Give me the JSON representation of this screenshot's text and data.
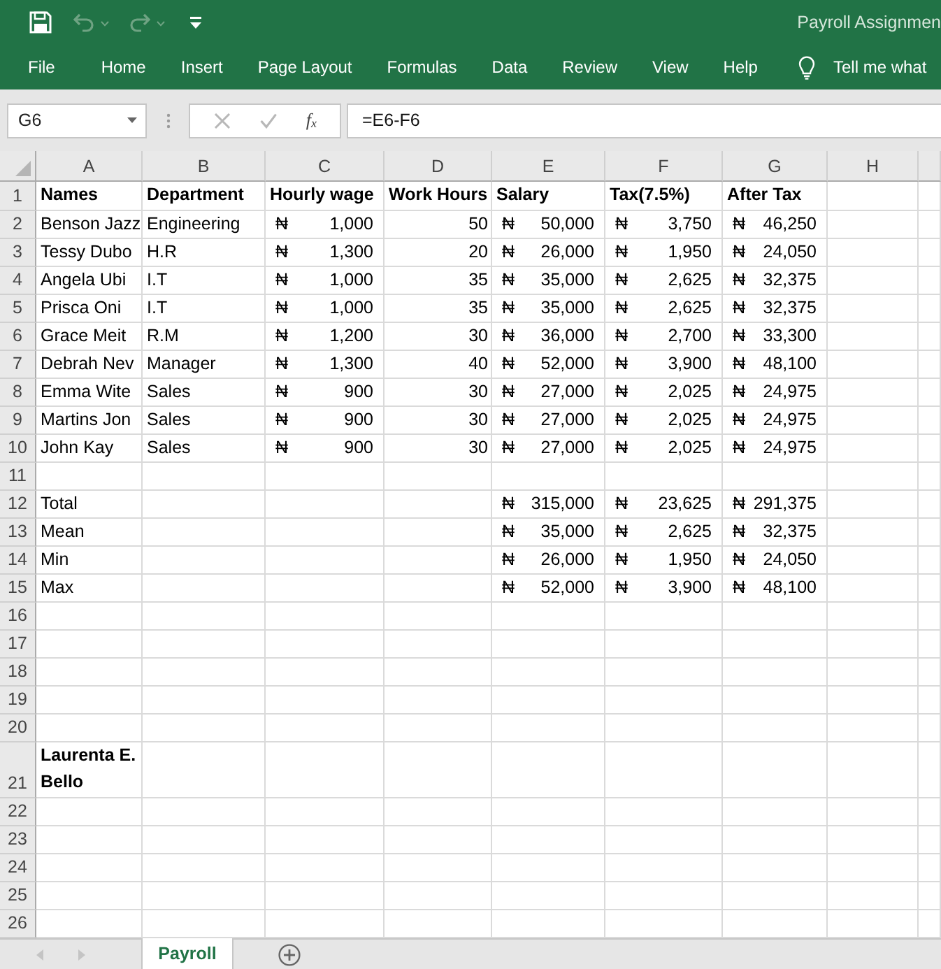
{
  "quick_access": [
    {
      "kind": "save",
      "disabled": false
    },
    {
      "kind": "undo",
      "disabled": true
    },
    {
      "kind": "redo",
      "disabled": true
    },
    {
      "kind": "customize",
      "disabled": false
    }
  ],
  "window": {
    "title": "Payroll Assignmen"
  },
  "menu": [
    "File",
    "Home",
    "Insert",
    "Page Layout",
    "Formulas",
    "Data",
    "Review",
    "View",
    "Help"
  ],
  "tell_me": "Tell me what",
  "formula_bar": {
    "name_box": "G6",
    "buttons": [
      {
        "kind": "cancel",
        "disabled": true
      },
      {
        "kind": "enter",
        "disabled": true
      },
      {
        "kind": "function",
        "label": "f$_{x}$",
        "disabled": false
      }
    ],
    "formula": "=E6-F6"
  },
  "sheet": {
    "columns": [
      "A",
      "B",
      "C",
      "D",
      "E",
      "F",
      "G",
      "H"
    ],
    "rows": [
      {
        "number": "1",
        "cells": [
          {
            "kind": "heading",
            "text": "Names"
          },
          {
            "kind": "heading",
            "text": "Department"
          },
          {
            "kind": "heading",
            "text": "Hourly wage"
          },
          {
            "kind": "heading",
            "text": "Work Hours"
          },
          {
            "kind": "heading",
            "text": "Salary"
          },
          {
            "kind": "heading",
            "text": "Tax(7.5%)"
          },
          {
            "kind": "heading",
            "text": "After Tax"
          }
        ]
      },
      {
        "number": "2",
        "cells": [
          {
            "kind": "text",
            "text": "Benson Jazz"
          },
          {
            "kind": "text",
            "text": "Engineering"
          },
          {
            "kind": "currency",
            "symbol": "₦",
            "amount": "1,000"
          },
          {
            "kind": "number",
            "text": "50"
          },
          {
            "kind": "currency",
            "symbol": "₦",
            "amount": "50,000"
          },
          {
            "kind": "currency",
            "symbol": "₦",
            "amount": "3,750"
          },
          {
            "kind": "currency",
            "symbol": "₦",
            "amount": "46,250"
          }
        ]
      },
      {
        "number": "3",
        "cells": [
          {
            "kind": "text",
            "text": "Tessy Dubo"
          },
          {
            "kind": "text",
            "text": "H.R"
          },
          {
            "kind": "currency",
            "symbol": "₦",
            "amount": "1,300"
          },
          {
            "kind": "number",
            "text": "20"
          },
          {
            "kind": "currency",
            "symbol": "₦",
            "amount": "26,000"
          },
          {
            "kind": "currency",
            "symbol": "₦",
            "amount": "1,950"
          },
          {
            "kind": "currency",
            "symbol": "₦",
            "amount": "24,050"
          }
        ]
      },
      {
        "number": "4",
        "cells": [
          {
            "kind": "text",
            "text": "Angela Ubi"
          },
          {
            "kind": "text",
            "text": "I.T"
          },
          {
            "kind": "currency",
            "symbol": "₦",
            "amount": "1,000"
          },
          {
            "kind": "number",
            "text": "35"
          },
          {
            "kind": "currency",
            "symbol": "₦",
            "amount": "35,000"
          },
          {
            "kind": "currency",
            "symbol": "₦",
            "amount": "2,625"
          },
          {
            "kind": "currency",
            "symbol": "₦",
            "amount": "32,375"
          }
        ]
      },
      {
        "number": "5",
        "cells": [
          {
            "kind": "text",
            "text": "Prisca Oni"
          },
          {
            "kind": "text",
            "text": "I.T"
          },
          {
            "kind": "currency",
            "symbol": "₦",
            "amount": "1,000"
          },
          {
            "kind": "number",
            "text": "35"
          },
          {
            "kind": "currency",
            "symbol": "₦",
            "amount": "35,000"
          },
          {
            "kind": "currency",
            "symbol": "₦",
            "amount": "2,625"
          },
          {
            "kind": "currency",
            "symbol": "₦",
            "amount": "32,375"
          }
        ]
      },
      {
        "number": "6",
        "cells": [
          {
            "kind": "text",
            "text": "Grace Meit"
          },
          {
            "kind": "text",
            "text": "R.M"
          },
          {
            "kind": "currency",
            "symbol": "₦",
            "amount": "1,200"
          },
          {
            "kind": "number",
            "text": "30"
          },
          {
            "kind": "currency",
            "symbol": "₦",
            "amount": "36,000"
          },
          {
            "kind": "currency",
            "symbol": "₦",
            "amount": "2,700"
          },
          {
            "kind": "currency",
            "symbol": "₦",
            "amount": "33,300"
          }
        ]
      },
      {
        "number": "7",
        "cells": [
          {
            "kind": "text",
            "text": "Debrah Nev"
          },
          {
            "kind": "text",
            "text": "Manager"
          },
          {
            "kind": "currency",
            "symbol": "₦",
            "amount": "1,300"
          },
          {
            "kind": "number",
            "text": "40"
          },
          {
            "kind": "currency",
            "symbol": "₦",
            "amount": "52,000"
          },
          {
            "kind": "currency",
            "symbol": "₦",
            "amount": "3,900"
          },
          {
            "kind": "currency",
            "symbol": "₦",
            "amount": "48,100"
          }
        ]
      },
      {
        "number": "8",
        "cells": [
          {
            "kind": "text",
            "text": "Emma Wite"
          },
          {
            "kind": "text",
            "text": "Sales"
          },
          {
            "kind": "currency",
            "symbol": "₦",
            "amount": "900"
          },
          {
            "kind": "number",
            "text": "30"
          },
          {
            "kind": "currency",
            "symbol": "₦",
            "amount": "27,000"
          },
          {
            "kind": "currency",
            "symbol": "₦",
            "amount": "2,025"
          },
          {
            "kind": "currency",
            "symbol": "₦",
            "amount": "24,975"
          }
        ]
      },
      {
        "number": "9",
        "cells": [
          {
            "kind": "text",
            "text": "Martins Jon"
          },
          {
            "kind": "text",
            "text": "Sales"
          },
          {
            "kind": "currency",
            "symbol": "₦",
            "amount": "900"
          },
          {
            "kind": "number",
            "text": "30"
          },
          {
            "kind": "currency",
            "symbol": "₦",
            "amount": "27,000"
          },
          {
            "kind": "currency",
            "symbol": "₦",
            "amount": "2,025"
          },
          {
            "kind": "currency",
            "symbol": "₦",
            "amount": "24,975"
          }
        ]
      },
      {
        "number": "10",
        "cells": [
          {
            "kind": "text",
            "text": "John Kay"
          },
          {
            "kind": "text",
            "text": "Sales"
          },
          {
            "kind": "currency",
            "symbol": "₦",
            "amount": "900"
          },
          {
            "kind": "number",
            "text": "30"
          },
          {
            "kind": "currency",
            "symbol": "₦",
            "amount": "27,000"
          },
          {
            "kind": "currency",
            "symbol": "₦",
            "amount": "2,025"
          },
          {
            "kind": "currency",
            "symbol": "₦",
            "amount": "24,975"
          }
        ]
      },
      {
        "number": "11"
      },
      {
        "number": "12",
        "cells": [
          {
            "kind": "text",
            "text": "Total"
          },
          {
            "kind": "blank"
          },
          {
            "kind": "blank"
          },
          {
            "kind": "blank"
          },
          {
            "kind": "currency",
            "symbol": "₦",
            "amount": "315,000"
          },
          {
            "kind": "currency",
            "symbol": "₦",
            "amount": "23,625"
          },
          {
            "kind": "currency",
            "symbol": "₦",
            "amount": "291,375"
          }
        ]
      },
      {
        "number": "13",
        "cells": [
          {
            "kind": "text",
            "text": "Mean"
          },
          {
            "kind": "blank"
          },
          {
            "kind": "blank"
          },
          {
            "kind": "blank"
          },
          {
            "kind": "currency",
            "symbol": "₦",
            "amount": "35,000"
          },
          {
            "kind": "currency",
            "symbol": "₦",
            "amount": "2,625"
          },
          {
            "kind": "currency",
            "symbol": "₦",
            "amount": "32,375"
          }
        ]
      },
      {
        "number": "14",
        "cells": [
          {
            "kind": "text",
            "text": "Min"
          },
          {
            "kind": "blank"
          },
          {
            "kind": "blank"
          },
          {
            "kind": "blank"
          },
          {
            "kind": "currency",
            "symbol": "₦",
            "amount": "26,000"
          },
          {
            "kind": "currency",
            "symbol": "₦",
            "amount": "1,950"
          },
          {
            "kind": "currency",
            "symbol": "₦",
            "amount": "24,050"
          }
        ]
      },
      {
        "number": "15",
        "cells": [
          {
            "kind": "text",
            "text": "Max"
          },
          {
            "kind": "blank"
          },
          {
            "kind": "blank"
          },
          {
            "kind": "blank"
          },
          {
            "kind": "currency",
            "symbol": "₦",
            "amount": "52,000"
          },
          {
            "kind": "currency",
            "symbol": "₦",
            "amount": "3,900"
          },
          {
            "kind": "currency",
            "symbol": "₦",
            "amount": "48,100"
          }
        ]
      },
      {
        "number": "16"
      },
      {
        "number": "17"
      },
      {
        "number": "18"
      },
      {
        "number": "19"
      },
      {
        "number": "20"
      },
      {
        "number": "21",
        "cells": [
          {
            "kind": "heading",
            "text": "Laurenta E. Bello"
          }
        ]
      },
      {
        "number": "22"
      },
      {
        "number": "23"
      },
      {
        "number": "24"
      },
      {
        "number": "25"
      },
      {
        "number": "26"
      }
    ]
  },
  "sheet_nav": [
    {
      "kind": "previous",
      "disabled": true
    },
    {
      "kind": "next",
      "disabled": true
    }
  ],
  "sheet_tabs": [
    {
      "label": "Payroll",
      "selected": true
    }
  ]
}
